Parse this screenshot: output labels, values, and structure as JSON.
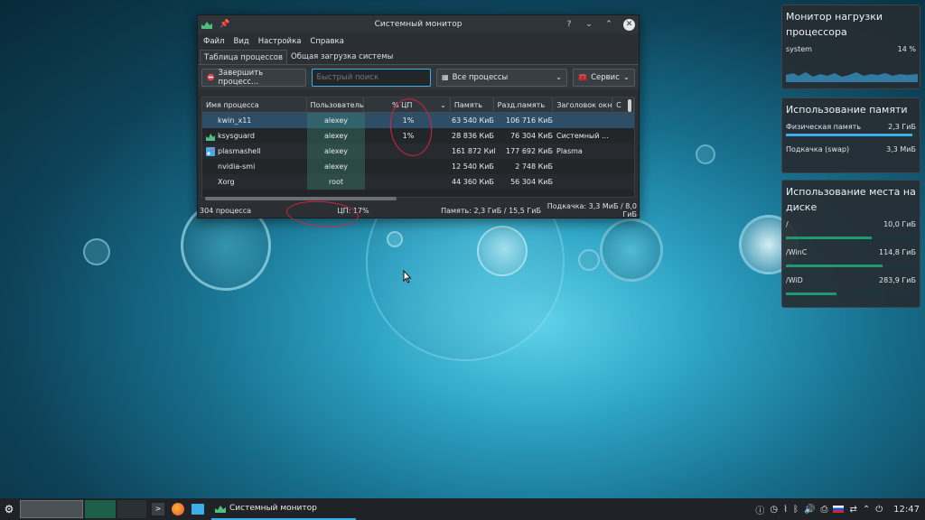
{
  "window": {
    "title": "Системный монитор",
    "buttons": [
      "?",
      "⌄",
      "⌃",
      "✕"
    ]
  },
  "menu": [
    "Файл",
    "Вид",
    "Настройка",
    "Справка"
  ],
  "tabs": [
    "Таблица процессов",
    "Общая загрузка системы"
  ],
  "toolbar": {
    "kill_label": "Завершить процесс...",
    "search_placeholder": "Быстрый поиск",
    "filter_label": "Все процессы",
    "tools_label": "Сервис"
  },
  "table": {
    "headers": [
      "Имя процесса",
      "Пользователь",
      "% ЦП",
      "Память",
      "Разд.память",
      "Заголовок окна",
      "С"
    ],
    "rows": [
      {
        "name": "kwin_x11",
        "user": "alexey",
        "cpu": "1%",
        "mem": "63 540 КиБ",
        "shm": "106 716 КиБ",
        "win": ""
      },
      {
        "name": "ksysguard",
        "user": "alexey",
        "cpu": "1%",
        "mem": "28 836 КиБ",
        "shm": "76 304 КиБ",
        "win": "Системный ..."
      },
      {
        "name": "plasmashell",
        "user": "alexey",
        "cpu": "",
        "mem": "161 872 КиБ",
        "shm": "177 692 КиБ",
        "win": "Plasma"
      },
      {
        "name": "nvidia-smi",
        "user": "alexey",
        "cpu": "",
        "mem": "12 540 КиБ",
        "shm": "2 748 КиБ",
        "win": ""
      },
      {
        "name": "Xorg",
        "user": "root",
        "cpu": "",
        "mem": "44 360 КиБ",
        "shm": "56 304 КиБ",
        "win": ""
      }
    ]
  },
  "status": {
    "processes": "304 процесса",
    "cpu": "ЦП: 17%",
    "memory": "Память: 2,3 ГиБ / 15,5 ГиБ",
    "swap": "Подкачка: 3,3 МиБ / 8,0 ГиБ"
  },
  "widgets": {
    "cpu": {
      "title": "Монитор нагрузки процессора",
      "label": "system",
      "value": "14 %"
    },
    "memory": {
      "title": "Использование памяти",
      "rows": [
        {
          "label": "Физическая память",
          "value": "2,3 ГиБ",
          "fraction": 0.97
        },
        {
          "label": "Подкачка (swap)",
          "value": "3,3 МиБ",
          "fraction": 0.0
        }
      ]
    },
    "disk": {
      "title": "Использование места на диске",
      "rows": [
        {
          "label": "/",
          "value": "10,0 ГиБ",
          "fraction": 0.66
        },
        {
          "label": "/WinC",
          "value": "114,8 ГиБ",
          "fraction": 0.74
        },
        {
          "label": "/WiD",
          "value": "283,9 ГиБ",
          "fraction": 0.39
        }
      ]
    }
  },
  "taskbar": {
    "task_label": "Системный монитор",
    "clock": "12:47"
  },
  "colors": {
    "accent": "#3daee9",
    "selection": "#2d4e66",
    "annotation": "#d8233a",
    "bar": "#1f9a6e"
  }
}
